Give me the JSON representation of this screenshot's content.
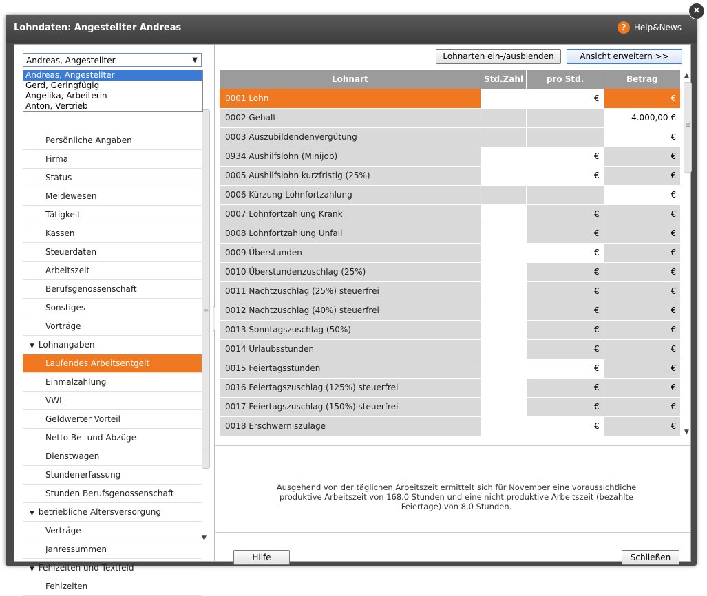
{
  "window": {
    "title": "Lohndaten: Angestellter Andreas",
    "help_label": "Help&News",
    "help_icon": "question-icon",
    "close_glyph": "×"
  },
  "employee_select": {
    "value": "Andreas, Angestellter",
    "arrow": "▼",
    "options": [
      "Andreas, Angestellter",
      "Gerd, Geringfügig",
      "Angelika, Arbeiterin",
      "Anton, Vertrieb"
    ]
  },
  "nav": [
    {
      "label": "Persönliche Angaben"
    },
    {
      "label": "Firma"
    },
    {
      "label": "Status"
    },
    {
      "label": "Meldewesen"
    },
    {
      "label": "Tätigkeit"
    },
    {
      "label": "Kassen"
    },
    {
      "label": "Steuerdaten"
    },
    {
      "label": "Arbeitszeit"
    },
    {
      "label": "Berufsgenossenschaft"
    },
    {
      "label": "Sonstiges"
    },
    {
      "label": "Vorträge"
    },
    {
      "label": "Lohnangaben",
      "group": true
    },
    {
      "label": "Laufendes Arbeitsentgelt",
      "active": true
    },
    {
      "label": "Einmalzahlung"
    },
    {
      "label": "VWL"
    },
    {
      "label": "Geldwerter Vorteil"
    },
    {
      "label": "Netto Be- und Abzüge"
    },
    {
      "label": "Dienstwagen"
    },
    {
      "label": "Stundenerfassung"
    },
    {
      "label": "Stunden Berufsgenossenschaft"
    },
    {
      "label": "betriebliche Altersversorgung",
      "group": true
    },
    {
      "label": "Verträge"
    },
    {
      "label": "Jahressummen"
    },
    {
      "label": "Fehlzeiten und Textfeld",
      "group": true
    },
    {
      "label": "Fehlzeiten"
    }
  ],
  "group_glyph": "▼",
  "toolbar": {
    "toggle_label": "Lohnarten ein-/ausblenden",
    "expand_label": "Ansicht erweitern >>"
  },
  "table": {
    "headers": [
      "Lohnart",
      "Std.Zahl",
      "pro Std.",
      "Betrag"
    ],
    "rows": [
      {
        "name": "0001 Lohn",
        "std": "",
        "pro": "€",
        "betrag": "€",
        "cstd": "w",
        "cpro": "w",
        "cb": "o",
        "selected": true
      },
      {
        "name": "0002 Gehalt",
        "std": "",
        "pro": "",
        "betrag": "4.000,00 €",
        "cstd": "g",
        "cpro": "g",
        "cb": "w"
      },
      {
        "name": "0003 Auszubildendenvergütung",
        "std": "",
        "pro": "",
        "betrag": "€",
        "cstd": "g",
        "cpro": "g",
        "cb": "w"
      },
      {
        "name": "0934 Aushilfslohn (Minijob)",
        "std": "",
        "pro": "€",
        "betrag": "€",
        "cstd": "w",
        "cpro": "w",
        "cb": "g"
      },
      {
        "name": "0005 Aushilfslohn kurzfristig (25%)",
        "std": "",
        "pro": "€",
        "betrag": "€",
        "cstd": "w",
        "cpro": "w",
        "cb": "g"
      },
      {
        "name": "0006 Kürzung Lohnfortzahlung",
        "std": "",
        "pro": "",
        "betrag": "€",
        "cstd": "g",
        "cpro": "g",
        "cb": "w"
      },
      {
        "name": "0007 Lohnfortzahlung Krank",
        "std": "",
        "pro": "€",
        "betrag": "€",
        "cstd": "w",
        "cpro": "g",
        "cb": "g"
      },
      {
        "name": "0008 Lohnfortzahlung Unfall",
        "std": "",
        "pro": "€",
        "betrag": "€",
        "cstd": "w",
        "cpro": "g",
        "cb": "g"
      },
      {
        "name": "0009 Überstunden",
        "std": "",
        "pro": "€",
        "betrag": "€",
        "cstd": "w",
        "cpro": "w",
        "cb": "g"
      },
      {
        "name": "0010 Überstundenzuschlag (25%)",
        "std": "",
        "pro": "€",
        "betrag": "€",
        "cstd": "w",
        "cpro": "g",
        "cb": "g"
      },
      {
        "name": "0011 Nachtzuschlag (25%) steuerfrei",
        "std": "",
        "pro": "€",
        "betrag": "€",
        "cstd": "w",
        "cpro": "g",
        "cb": "g"
      },
      {
        "name": "0012 Nachtzuschlag (40%) steuerfrei",
        "std": "",
        "pro": "€",
        "betrag": "€",
        "cstd": "w",
        "cpro": "g",
        "cb": "g"
      },
      {
        "name": "0013 Sonntagszuschlag (50%)",
        "std": "",
        "pro": "€",
        "betrag": "€",
        "cstd": "w",
        "cpro": "g",
        "cb": "g"
      },
      {
        "name": "0014 Urlaubsstunden",
        "std": "",
        "pro": "€",
        "betrag": "€",
        "cstd": "w",
        "cpro": "g",
        "cb": "g"
      },
      {
        "name": "0015 Feiertagsstunden",
        "std": "",
        "pro": "€",
        "betrag": "€",
        "cstd": "w",
        "cpro": "w",
        "cb": "g"
      },
      {
        "name": "0016 Feiertagszuschlag (125%) steuerfrei",
        "std": "",
        "pro": "€",
        "betrag": "€",
        "cstd": "w",
        "cpro": "g",
        "cb": "g"
      },
      {
        "name": "0017 Feiertagszuschlag (150%) steuerfrei",
        "std": "",
        "pro": "€",
        "betrag": "€",
        "cstd": "w",
        "cpro": "g",
        "cb": "g"
      },
      {
        "name": "0018 Erschwerniszulage",
        "std": "",
        "pro": "€",
        "betrag": "€",
        "cstd": "w",
        "cpro": "w",
        "cb": "g"
      }
    ]
  },
  "info_text": "Ausgehend von der täglichen Arbeitszeit ermittelt sich für November eine voraussichtliche produktive Arbeitszeit von 168.0 Stunden und eine nicht produktive Arbeitszeit (bezahlte Feiertage) von 8.0 Stunden.",
  "footer": {
    "help_button": "Hilfe",
    "close_button": "Schließen"
  },
  "colors": {
    "accent": "#f07820",
    "header_gray": "#9b9b9b",
    "cell_gray": "#d9d9d9",
    "window_dark": "#4a4a4a"
  }
}
